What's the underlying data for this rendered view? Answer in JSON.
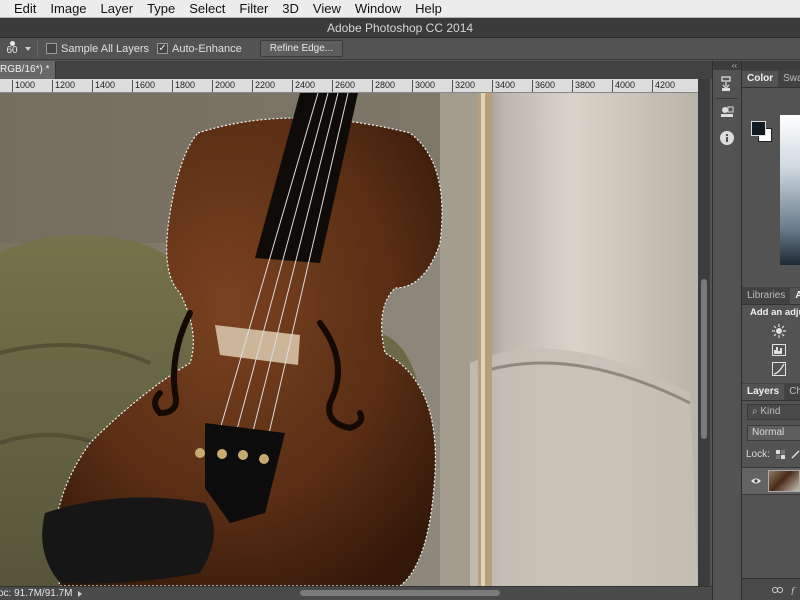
{
  "menu": [
    "Edit",
    "Image",
    "Layer",
    "Type",
    "Select",
    "Filter",
    "3D",
    "View",
    "Window",
    "Help"
  ],
  "window_title": "Adobe Photoshop CC 2014",
  "options": {
    "brush_size": "60",
    "sample_all_layers": "Sample All Layers",
    "sample_all_layers_checked": false,
    "auto_enhance": "Auto-Enhance",
    "auto_enhance_checked": true,
    "refine_edge": "Refine Edge..."
  },
  "document_tab": "RGB/16*) *",
  "ruler_ticks": [
    "1000",
    "1200",
    "1400",
    "1600",
    "1800",
    "2000",
    "2200",
    "2400",
    "2600",
    "2800",
    "3000",
    "3200",
    "3400",
    "3600",
    "3800",
    "4000",
    "4200"
  ],
  "status": "oc: 91.7M/91.7M",
  "panels": {
    "color_tabs": [
      "Color",
      "Swat"
    ],
    "library_tabs": [
      "Libraries",
      "A"
    ],
    "adjustments_title": "Add an adjus",
    "layers_tabs": [
      "Layers",
      "Cha"
    ],
    "kind_label": "Kind",
    "blend_mode": "Normal",
    "lock_label": "Lock:"
  },
  "colors": {
    "foreground": "#0f1a22",
    "background": "#ffffff",
    "app_bg": "#535353"
  }
}
